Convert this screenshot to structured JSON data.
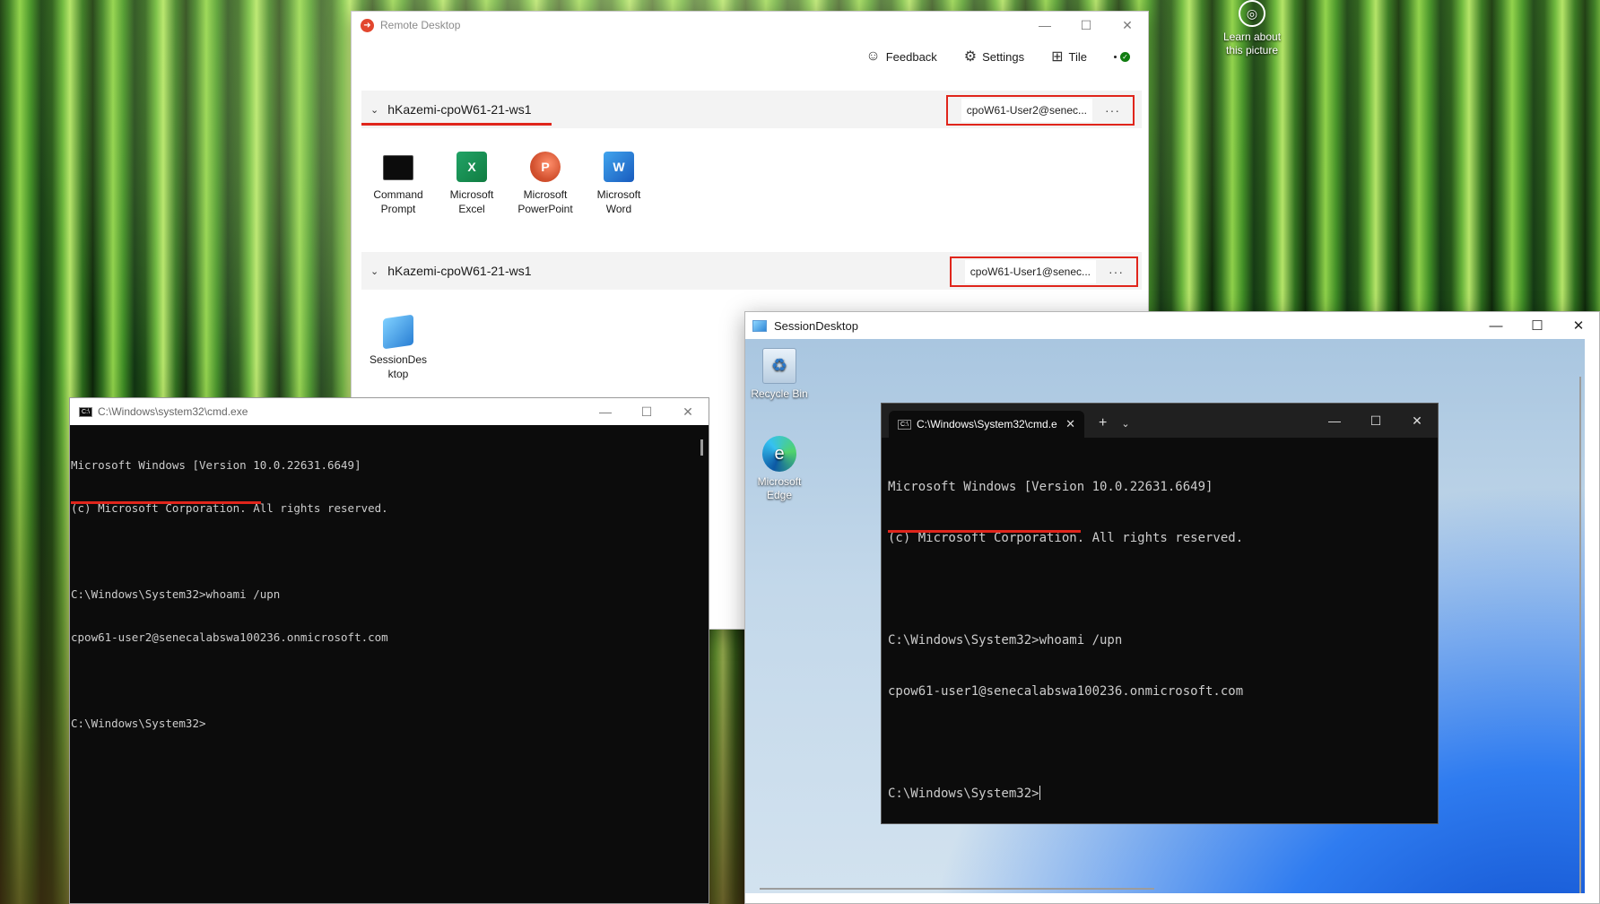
{
  "desktop": {
    "learn_about_line1": "Learn about",
    "learn_about_line2": "this picture"
  },
  "remote_desktop": {
    "title": "Remote Desktop",
    "toolbar": {
      "feedback": "Feedback",
      "settings": "Settings",
      "tile": "Tile"
    },
    "workspaces": [
      {
        "name": "hKazemi-cpoW61-21-ws1",
        "user": "cpoW61-User2@senec...",
        "apps": [
          {
            "line1": "Command",
            "line2": "Prompt"
          },
          {
            "line1": "Microsoft",
            "line2": "Excel"
          },
          {
            "line1": "Microsoft",
            "line2": "PowerPoint"
          },
          {
            "line1": "Microsoft",
            "line2": "Word"
          }
        ]
      },
      {
        "name": "hKazemi-cpoW61-21-ws1",
        "user": "cpoW61-User1@senec...",
        "apps": [
          {
            "line1": "SessionDes",
            "line2": "ktop"
          }
        ]
      }
    ]
  },
  "cmd_local": {
    "title": "C:\\Windows\\system32\\cmd.exe",
    "lines": [
      "Microsoft Windows [Version 10.0.22631.6649]",
      "(c) Microsoft Corporation. All rights reserved.",
      "",
      "C:\\Windows\\System32>whoami /upn",
      "cpow61-user2@senecalabswa100236.onmicrosoft.com",
      "",
      "C:\\Windows\\System32>"
    ]
  },
  "session_desktop": {
    "title": "SessionDesktop",
    "icons": {
      "recycle_bin": "Recycle Bin",
      "edge_line1": "Microsoft",
      "edge_line2": "Edge"
    },
    "terminal": {
      "tab_title": "C:\\Windows\\System32\\cmd.e",
      "lines": [
        "Microsoft Windows [Version 10.0.22631.6649]",
        "(c) Microsoft Corporation. All rights reserved.",
        "",
        "C:\\Windows\\System32>whoami /upn",
        "cpow61-user1@senecalabswa100236.onmicrosoft.com",
        "",
        "C:\\Windows\\System32>"
      ]
    }
  },
  "colors": {
    "highlight_red": "#e0251b",
    "terminal_bg": "#0c0c0c",
    "terminal_text": "#cccccc"
  }
}
